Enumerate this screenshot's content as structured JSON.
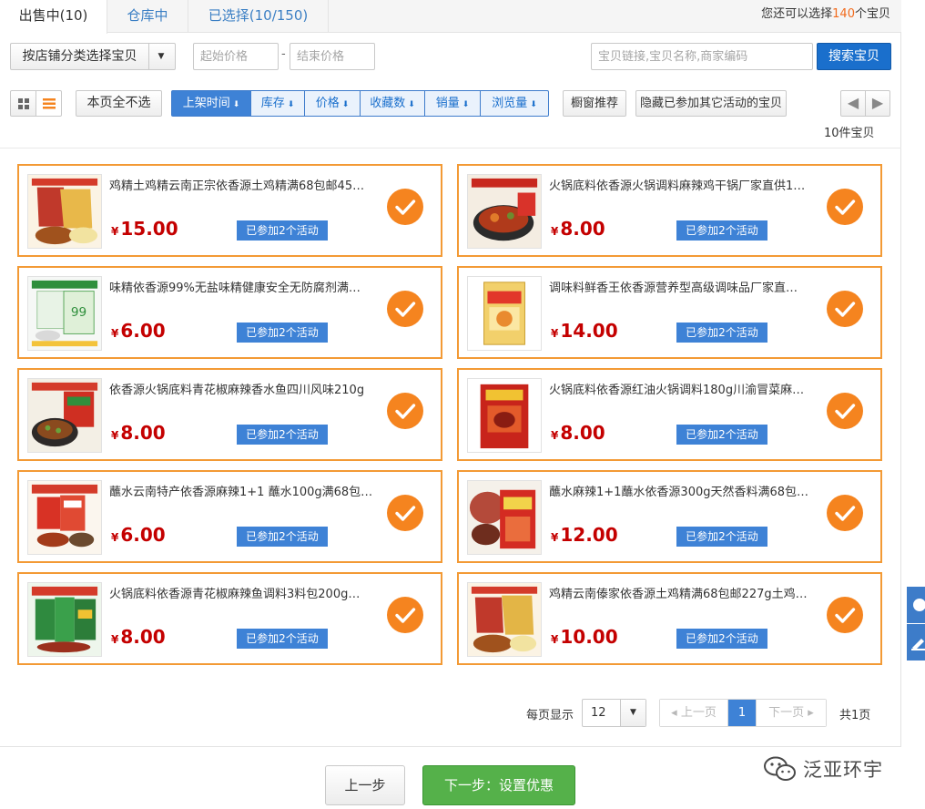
{
  "tabs": [
    {
      "label": "出售中(10)",
      "active": true
    },
    {
      "label": "仓库中",
      "active": false
    },
    {
      "label": "已选择(10/150)",
      "active": false
    }
  ],
  "quota": {
    "prefix": "您还可以选择",
    "count": "140",
    "suffix": "个宝贝"
  },
  "filters": {
    "category_label": "按店铺分类选择宝贝",
    "price_min_placeholder": "起始价格",
    "price_separator": "-",
    "price_max_placeholder": "结束价格",
    "search_placeholder": "宝贝链接,宝贝名称,商家编码",
    "search_button": "搜索宝贝"
  },
  "toolbar": {
    "unselect_label": "本页全不选",
    "sort_options": [
      {
        "label": "上架时间",
        "active": true
      },
      {
        "label": "库存",
        "active": false
      },
      {
        "label": "价格",
        "active": false
      },
      {
        "label": "收藏数",
        "active": false
      },
      {
        "label": "销量",
        "active": false
      },
      {
        "label": "浏览量",
        "active": false
      }
    ],
    "window_label": "橱窗推荐",
    "hide_label": "隐藏已参加其它活动的宝贝",
    "count_label": "10件宝贝"
  },
  "currency_symbol": "¥",
  "items": [
    {
      "title": "鸡精土鸡精云南正宗依香源土鸡精满68包邮45…",
      "price": "15.00",
      "badge": "已参加2个活动",
      "selected": true,
      "image": "chicken-essence-pack"
    },
    {
      "title": "火锅底料依香源火锅调料麻辣鸡干锅厂家直供1…",
      "price": "8.00",
      "badge": "已参加2个活动",
      "selected": true,
      "image": "spicy-pot-dish"
    },
    {
      "title": "味精依香源99%无盐味精健康安全无防腐剂满…",
      "price": "6.00",
      "badge": "已参加2个活动",
      "selected": true,
      "image": "msg-pack"
    },
    {
      "title": "调味料鲜香王依香源营养型高级调味品厂家直…",
      "price": "14.00",
      "badge": "已参加2个活动",
      "selected": true,
      "image": "seasoning-bag"
    },
    {
      "title": "依香源火锅底料青花椒麻辣香水鱼四川风味210g",
      "price": "8.00",
      "badge": "已参加2个活动",
      "selected": true,
      "image": "fish-hotpot-pack"
    },
    {
      "title": "火锅底料依香源红油火锅调料180g川渝冒菜麻…",
      "price": "8.00",
      "badge": "已参加2个活动",
      "selected": true,
      "image": "red-oil-pack"
    },
    {
      "title": "蘸水云南特产依香源麻辣1+1 蘸水100g满68包…",
      "price": "6.00",
      "badge": "已参加2个活动",
      "selected": true,
      "image": "dip-packs"
    },
    {
      "title": "蘸水麻辣1+1蘸水依香源300g天然香料满68包…",
      "price": "12.00",
      "badge": "已参加2个活动",
      "selected": true,
      "image": "dip-bag-large"
    },
    {
      "title": "火锅底料依香源青花椒麻辣鱼调料3料包200g…",
      "price": "8.00",
      "badge": "已参加2个活动",
      "selected": true,
      "image": "green-pepper-packs"
    },
    {
      "title": "鸡精云南傣家依香源土鸡精满68包邮227g土鸡…",
      "price": "10.00",
      "badge": "已参加2个活动",
      "selected": true,
      "image": "chicken-essence-pack-2"
    }
  ],
  "pagination": {
    "per_page_label": "每页显示",
    "per_page_value": "12",
    "prev_label": "上一页",
    "current_page": "1",
    "next_label": "下一页",
    "total_label": "共1页"
  },
  "footer": {
    "prev_step_label": "上一步",
    "next_step_label": "下一步：设置优惠"
  },
  "watermark": {
    "text": "泛亚环宇"
  },
  "colors": {
    "accent_blue": "#3e82d6",
    "card_border_orange": "#f39a35",
    "check_orange": "#f5841f",
    "price_red": "#c40000",
    "next_step_green": "#55b14a",
    "quota_orange": "#f26b1d"
  }
}
